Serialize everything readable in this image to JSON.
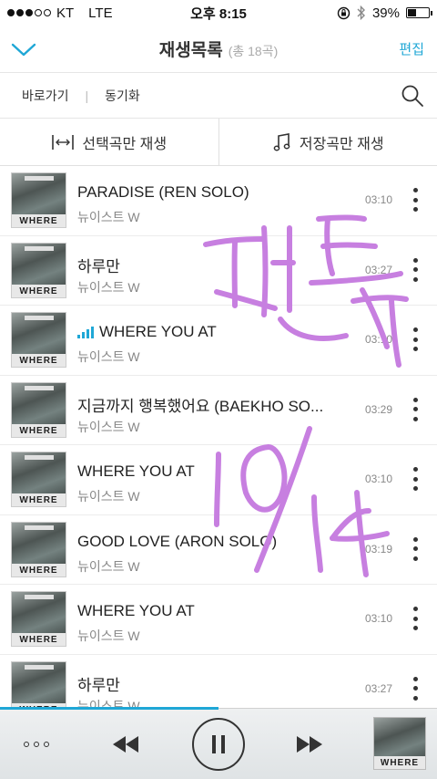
{
  "status": {
    "carrier": "KT",
    "network": "LTE",
    "time": "오후 8:15",
    "battery": "39%",
    "battery_level": 0.39,
    "signal_bars": 3
  },
  "header": {
    "title": "재생목록",
    "count": "(총 18곡)",
    "edit_label": "편집"
  },
  "subbar": {
    "shortcut": "바로가기",
    "sync": "동기화"
  },
  "actions": {
    "play_selected": "선택곡만 재생",
    "play_saved": "저장곡만 재생"
  },
  "album_label": "WHERE",
  "songs": [
    {
      "title": "PARADISE (REN SOLO)",
      "artist": "뉴이스트 W",
      "duration": "03:10",
      "playing": false
    },
    {
      "title": "하루만",
      "artist": "뉴이스트 W",
      "duration": "03:27",
      "playing": false
    },
    {
      "title": "WHERE YOU AT",
      "artist": "뉴이스트 W",
      "duration": "03:10",
      "playing": true
    },
    {
      "title": "지금까지 행복했어요 (BAEKHO SO...",
      "artist": "뉴이스트 W",
      "duration": "03:29",
      "playing": false
    },
    {
      "title": "WHERE YOU AT",
      "artist": "뉴이스트 W",
      "duration": "03:10",
      "playing": false
    },
    {
      "title": "GOOD LOVE (ARON SOLO)",
      "artist": "뉴이스트 W",
      "duration": "03:19",
      "playing": false
    },
    {
      "title": "WHERE YOU AT",
      "artist": "뉴이스트 W",
      "duration": "03:10",
      "playing": false
    },
    {
      "title": "하루만",
      "artist": "뉴이스트 W",
      "duration": "03:27",
      "playing": false
    }
  ],
  "player": {
    "progress": 0.5
  },
  "colors": {
    "accent": "#1fa7d6",
    "handwriting": "#c77fe0"
  }
}
